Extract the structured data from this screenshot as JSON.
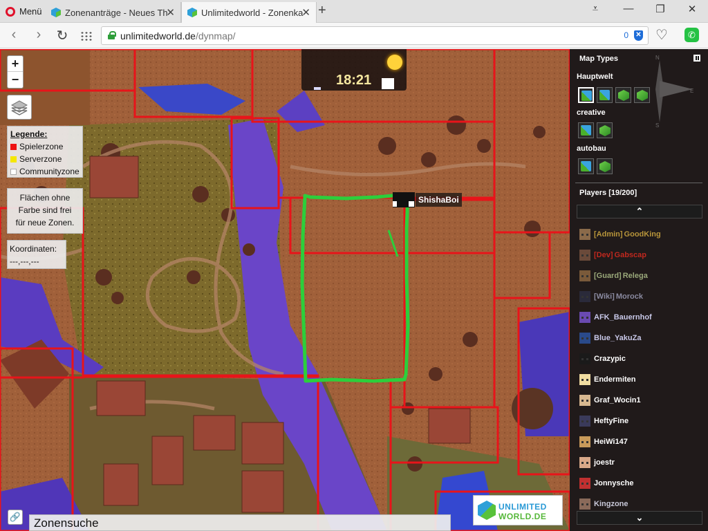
{
  "browser": {
    "menu_label": "Menü",
    "tabs": [
      {
        "title": "Zonenanträge - Neues The",
        "active": false
      },
      {
        "title": "Unlimitedworld - Zonenka",
        "active": true
      }
    ],
    "url_host": "unlimitedworld.de",
    "url_path": "/dynmap/",
    "blocked_count": "0"
  },
  "map": {
    "zoom_in": "+",
    "zoom_out": "−",
    "legend": {
      "title": "Legende:",
      "items": [
        {
          "label": "Spielerzone",
          "color": "#ee1111"
        },
        {
          "label": "Serverzone",
          "color": "#f5e700"
        },
        {
          "label": "Communityzone",
          "color": "#ffffff"
        }
      ]
    },
    "free_note": [
      "Flächen ohne",
      "Farbe sind frei",
      "für neue Zonen."
    ],
    "coords_label": "Koordinaten:",
    "coords_value": "---,---,---",
    "clock_time": "18:21",
    "marker_player": "ShishaBoi",
    "search_label": "Zonensuche",
    "logo_line1": "UNLIMITED",
    "logo_line2": "WORLD.DE",
    "zone_color": "#e8141a",
    "drawn_outline_color": "#2ccf3b"
  },
  "sidebar": {
    "map_types_title": "Map Types",
    "compass": {
      "n": "N",
      "e": "E",
      "s": "S"
    },
    "worlds": [
      {
        "name": "Hauptwelt",
        "icons": [
          "flat-map-icon",
          "flat-map-icon",
          "cube-map-icon",
          "cube-map-icon"
        ]
      },
      {
        "name": "creative",
        "icons": [
          "flat-map-icon",
          "cube-map-icon"
        ]
      },
      {
        "name": "autobau",
        "icons": [
          "flat-map-icon",
          "cube-map-icon"
        ]
      }
    ],
    "players_title": "Players [19/200]",
    "scroll_up": "⌃",
    "scroll_down": "⌄",
    "players": [
      {
        "prefix": "[Admin]",
        "name": "GoodKing",
        "color": "#b8953a",
        "skin": "#8a6a4a"
      },
      {
        "prefix": "[Dev]",
        "name": "Gabscap",
        "color": "#c0281e",
        "skin": "#6a4a3a"
      },
      {
        "prefix": "[Guard]",
        "name": "Relega",
        "color": "#9aa87a",
        "skin": "#7a5a3a"
      },
      {
        "prefix": "[Wiki]",
        "name": "Morock",
        "color": "#8a8aa0",
        "skin": "#2a2a3a"
      },
      {
        "prefix": "",
        "name": "AFK_Bauernhof",
        "color": "#c8c8e8",
        "skin": "#6a4ab0"
      },
      {
        "prefix": "",
        "name": "Blue_YakuZa",
        "color": "#c8c8e8",
        "skin": "#2a4a8a"
      },
      {
        "prefix": "",
        "name": "Crazypic",
        "color": "#ffffff",
        "skin": "#1a1a1a"
      },
      {
        "prefix": "",
        "name": "Endermiten",
        "color": "#ffffff",
        "skin": "#f0dca0"
      },
      {
        "prefix": "",
        "name": "Graf_Wocin1",
        "color": "#ffffff",
        "skin": "#d8b890"
      },
      {
        "prefix": "",
        "name": "HeftyFine",
        "color": "#ffffff",
        "skin": "#3a3a5a"
      },
      {
        "prefix": "",
        "name": "HeiWi147",
        "color": "#ffffff",
        "skin": "#c89a5a"
      },
      {
        "prefix": "",
        "name": "joestr",
        "color": "#ffffff",
        "skin": "#d8a888"
      },
      {
        "prefix": "",
        "name": "Jonnysche",
        "color": "#ffffff",
        "skin": "#c03030"
      },
      {
        "prefix": "",
        "name": "Kingzone",
        "color": "#c8c8d8",
        "skin": "#8a6a5a"
      }
    ]
  }
}
